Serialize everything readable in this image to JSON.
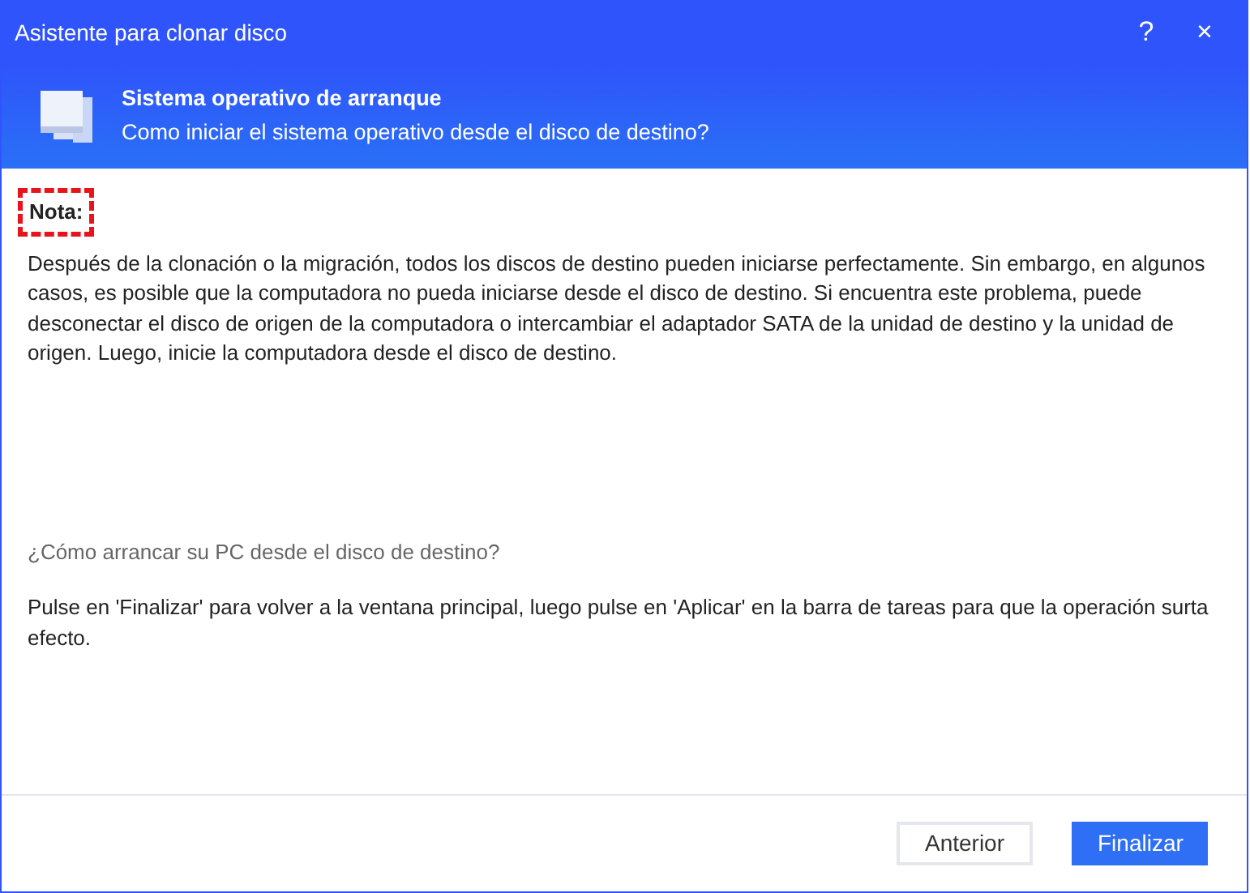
{
  "window": {
    "title": "Asistente para clonar disco",
    "help": "?",
    "close": "×"
  },
  "header": {
    "title": "Sistema operativo de arranque",
    "subtitle": "Como iniciar el sistema operativo desde el disco de destino?"
  },
  "note": {
    "label": "Nota:",
    "highlighted": true,
    "text": "Después de la clonación o la migración, todos los discos de destino pueden iniciarse perfectamente. Sin embargo, en algunos casos, es posible que la computadora no pueda iniciarse desde el disco de destino. Si encuentra este problema, puede desconectar el disco de origen de la computadora o intercambiar el adaptador SATA de la unidad de destino y la unidad de origen. Luego, inicie la computadora desde el disco de destino."
  },
  "howto": {
    "question": "¿Cómo arrancar su PC desde el disco de destino?",
    "text": "Pulse en 'Finalizar' para volver a la ventana principal, luego pulse en 'Aplicar' en la barra de tareas para que la operación surta efecto."
  },
  "buttons": [
    {
      "label": "Anterior",
      "kind": "secondary"
    },
    {
      "label": "Finalizar",
      "kind": "primary"
    }
  ]
}
